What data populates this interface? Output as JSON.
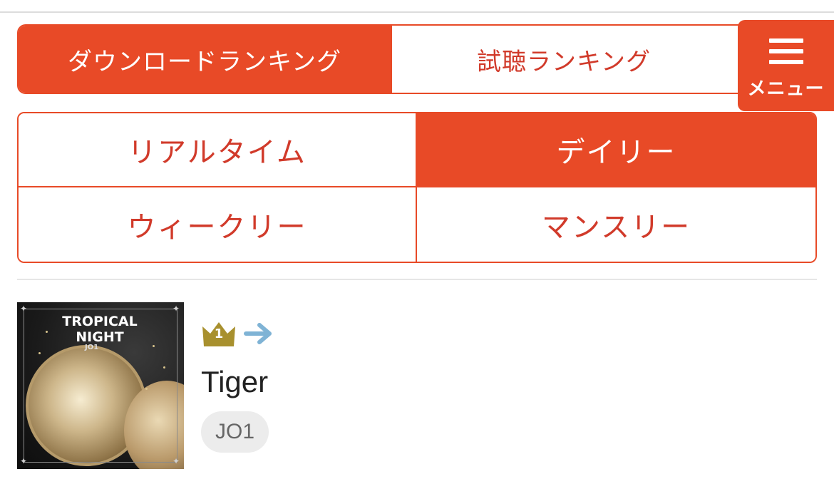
{
  "primary_tabs": [
    {
      "label": "ダウンロードランキング",
      "active": true
    },
    {
      "label": "試聴ランキング",
      "active": false
    }
  ],
  "menu": {
    "label": "メニュー",
    "icon": "hamburger-icon"
  },
  "period_tabs": [
    {
      "label": "リアルタイム",
      "active": false
    },
    {
      "label": "デイリー",
      "active": true
    },
    {
      "label": "ウィークリー",
      "active": false
    },
    {
      "label": "マンスリー",
      "active": false
    }
  ],
  "ranking": [
    {
      "rank": "1",
      "trend_icon": "arrow-right-icon",
      "title": "Tiger",
      "artist": "JO1",
      "cover": {
        "title": "TROPICAL NIGHT",
        "artist": "JO1"
      }
    }
  ],
  "colors": {
    "accent": "#e84a27",
    "text_red": "#d13a2a",
    "crown": "#a8902e",
    "arrow": "#7fb3d5",
    "chip_bg": "#ececec"
  }
}
